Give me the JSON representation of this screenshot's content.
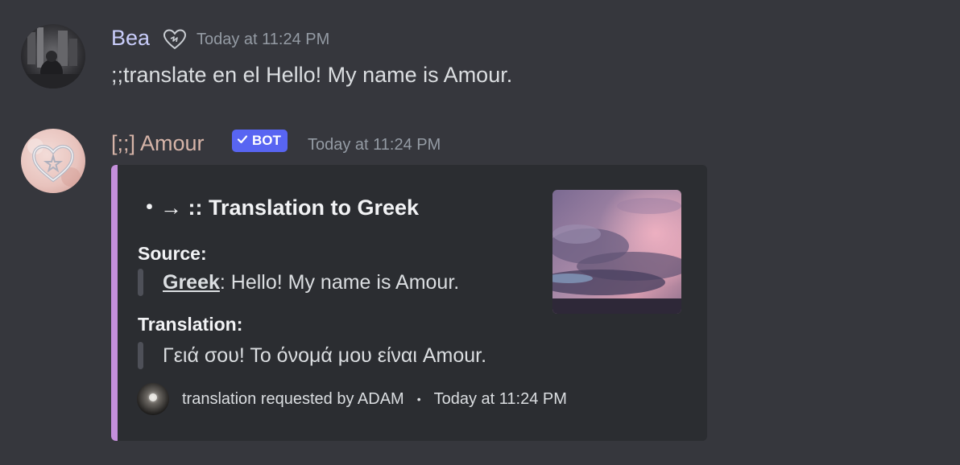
{
  "messages": [
    {
      "author": "Bea",
      "author_color": "#c9cdfb",
      "badge_icon": "heart-outline-icon",
      "timestamp": "Today at 11:24 PM",
      "content": ";;translate en el Hello! My name is Amour."
    },
    {
      "author": "[;;] Amour",
      "author_color": "#d6b4a8",
      "bot_tag": "BOT",
      "timestamp": "Today at 11:24 PM",
      "embed": {
        "accent_color": "#c48fdb",
        "title": "・→ :: Translation to Greek",
        "fields": [
          {
            "name": "Source:",
            "link_text": "Greek",
            "value": ": Hello! My name is Amour."
          },
          {
            "name": "Translation:",
            "value": "Γειά σου! Το όνομά μου είναι Amour."
          }
        ],
        "footer": {
          "text": "translation requested by ADAM",
          "separator": "•",
          "timestamp": "Today at 11:24 PM"
        }
      }
    }
  ]
}
